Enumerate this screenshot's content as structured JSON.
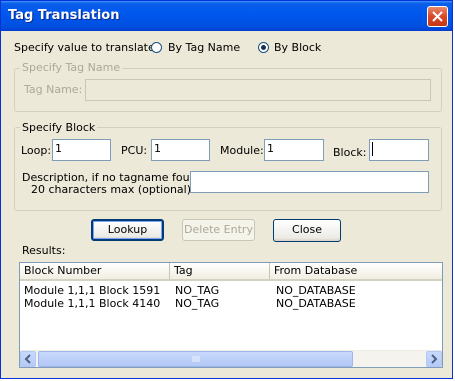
{
  "window": {
    "title": "Tag Translation"
  },
  "translate": {
    "label": "Specify value to translate:",
    "options": [
      {
        "label": "By Tag Name",
        "selected": false
      },
      {
        "label": "By Block",
        "selected": true
      }
    ]
  },
  "tag_group": {
    "title": "Specify Tag Name",
    "tag_name_label": "Tag Name:",
    "tag_name_value": ""
  },
  "block_group": {
    "title": "Specify Block",
    "loop_label": "Loop:",
    "loop_value": "1",
    "pcu_label": "PCU:",
    "pcu_value": "1",
    "module_label": "Module:",
    "module_value": "1",
    "block_label": "Block:",
    "block_value": "",
    "description_label_line1": "Description, if no tagname found -",
    "description_label_line2": "20 characters max (optional):",
    "description_value": ""
  },
  "buttons": {
    "lookup": "Lookup",
    "delete_entry": "Delete Entry",
    "close": "Close"
  },
  "results": {
    "label": "Results:",
    "columns": [
      "Block Number",
      "Tag",
      "From Database"
    ],
    "rows": [
      [
        "Module 1,1,1 Block 1591",
        "NO_TAG",
        "NO_DATABASE"
      ],
      [
        "Module 1,1,1 Block 4140",
        "NO_TAG",
        "NO_DATABASE"
      ]
    ]
  },
  "colors": {
    "titlebar": "#0058ee",
    "dialog_bg": "#ece9d8",
    "close_button": "#d8472a"
  }
}
